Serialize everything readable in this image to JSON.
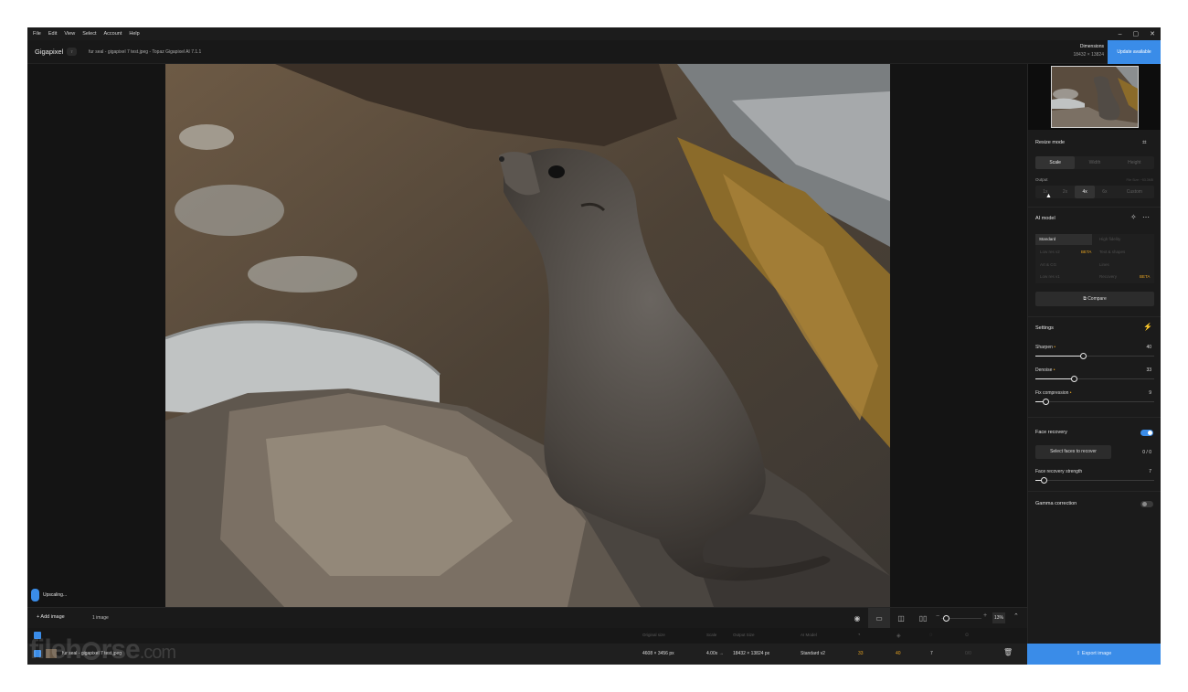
{
  "menu": [
    "File",
    "Edit",
    "View",
    "Select",
    "Account",
    "Help"
  ],
  "window_controls": [
    "–",
    "▢",
    "✕"
  ],
  "app": {
    "brand": "Gigapixel",
    "version_badge": "7",
    "doc_title": "fur seal - gigapixel 7 test.jpeg - Topaz Gigapixel AI 7.1.1",
    "dimensions_label": "Dimensions",
    "dimensions_value": "18432 × 13824",
    "update_label": "Update available"
  },
  "status": {
    "upscaling": "Upscaling..."
  },
  "sidebar": {
    "resize_mode": {
      "title": "Resize mode",
      "tabs": [
        "Scale",
        "Width",
        "Height"
      ],
      "active": "Scale"
    },
    "output": {
      "label": "Output",
      "hint": "File Size: ~53.3MB",
      "options": [
        "1x",
        "2x",
        "4x",
        "6x",
        "Custom"
      ],
      "active": "4x"
    },
    "ai_model": {
      "title": "AI model",
      "models": [
        {
          "name": "Standard",
          "selected": true
        },
        {
          "name": "High fidelity"
        },
        {
          "name": "Low res v2",
          "badge": "BETA"
        },
        {
          "name": "Text & shapes"
        },
        {
          "name": "Art & CG"
        },
        {
          "name": "Lines"
        },
        {
          "name": "Low res v1"
        },
        {
          "name": "Recovery",
          "badge": "BETA"
        }
      ],
      "compare_label": "Compare"
    },
    "settings": {
      "title": "Settings",
      "sliders": [
        {
          "label": "Sharpen",
          "value": "40",
          "fraction": 0.4
        },
        {
          "label": "Denoise",
          "value": "33",
          "fraction": 0.33
        },
        {
          "label": "Fix compression",
          "value": "9",
          "fraction": 0.09
        }
      ]
    },
    "face_recovery": {
      "title": "Face recovery",
      "enabled": true,
      "select_label": "Select faces to recover",
      "count": "0 / 0",
      "strength_label": "Face recovery strength",
      "strength_value": "7",
      "strength_fraction": 0.07
    },
    "gamma": {
      "title": "Gamma correction",
      "enabled": false
    }
  },
  "bottom": {
    "add_image": "+ Add image",
    "image_count": "1 image",
    "zoom": "13%"
  },
  "table": {
    "headers": [
      "Original size",
      "Scale",
      "Output Size",
      "AI Model"
    ],
    "row": {
      "file": "fur seal - gigapixel 7 test.jpeg",
      "original_size": "4608 × 3456 px",
      "scale": "4.00x →",
      "output_size": "18432 × 13824 px",
      "model": "Standard v2",
      "sharpen": "33",
      "denoise": "40",
      "compression": "7",
      "face": "0/0"
    }
  },
  "export_label": "Export image",
  "watermark": {
    "main": "fileh",
    "mid": "rse",
    "tail": ".com"
  },
  "colors": {
    "accent": "#3a8ce8",
    "beta": "#e6a321",
    "panel": "#1b1b1b",
    "bg": "#141414"
  }
}
